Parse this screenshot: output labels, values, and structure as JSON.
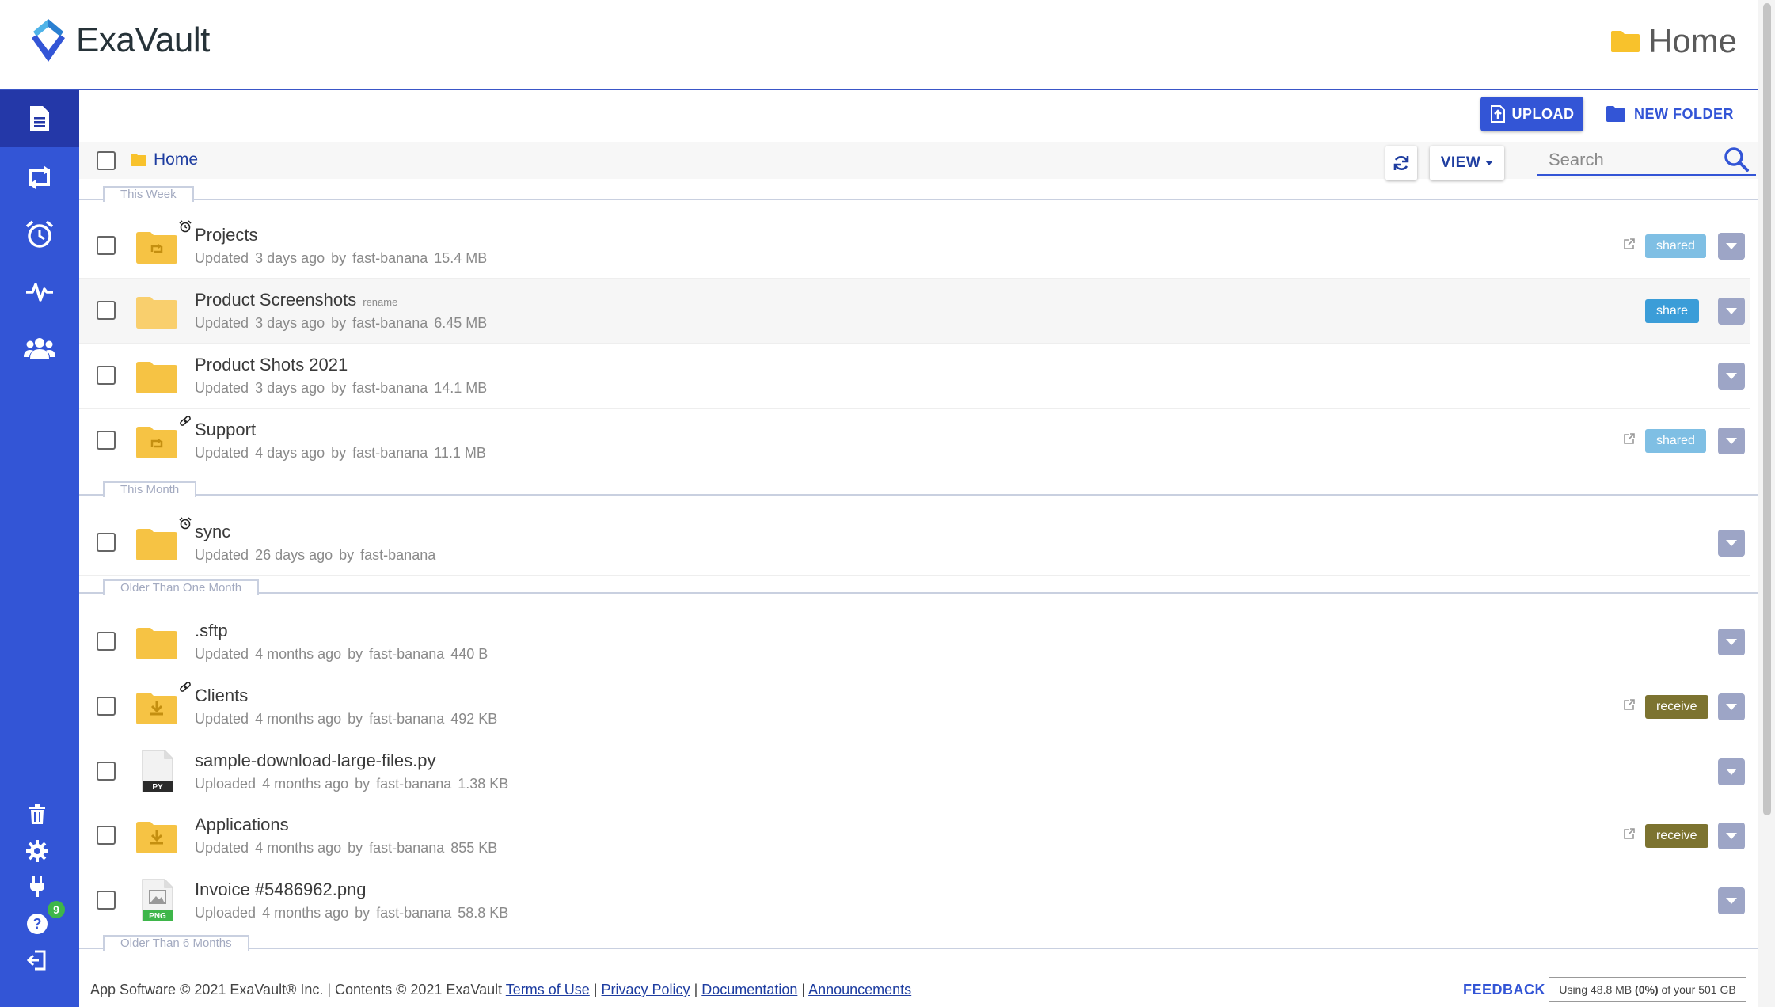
{
  "app": {
    "name": "ExaVault"
  },
  "header": {
    "title": "Home"
  },
  "actions": {
    "upload_label": "UPLOAD",
    "new_folder_label": "NEW FOLDER"
  },
  "toolbar": {
    "breadcrumb": "Home",
    "view_label": "VIEW",
    "search_placeholder": "Search"
  },
  "sidebar": {
    "items": [
      {
        "icon": "file-icon",
        "active": true
      },
      {
        "icon": "sync-icon",
        "active": false
      },
      {
        "icon": "alarm-clock-icon",
        "active": false
      },
      {
        "icon": "activity-icon",
        "active": false
      },
      {
        "icon": "users-icon",
        "active": false
      }
    ],
    "bottom_items": [
      "trash-icon",
      "gear-icon",
      "plug-icon",
      "help-icon",
      "logout-icon"
    ],
    "help_badge": "9"
  },
  "groups": [
    {
      "label": "This Week"
    },
    {
      "label": "This Month"
    },
    {
      "label": "Older Than One Month"
    },
    {
      "label": "Older Than 6 Months"
    }
  ],
  "files": [
    {
      "name": "Projects",
      "action": "Updated",
      "age": "3 days ago",
      "by": "by",
      "user": "fast-banana",
      "size": "15.4 MB",
      "icon": "sync-folder-icon",
      "indicator": "alarm-icon",
      "share_status": "shared"
    },
    {
      "name": "Product Screenshots",
      "hint": "rename",
      "action": "Updated",
      "age": "3 days ago",
      "by": "by",
      "user": "fast-banana",
      "size": "6.45 MB",
      "icon": "folder-icon",
      "share_status": "share"
    },
    {
      "name": "Product Shots 2021",
      "action": "Updated",
      "age": "3 days ago",
      "by": "by",
      "user": "fast-banana",
      "size": "14.1 MB",
      "icon": "folder-icon"
    },
    {
      "name": "Support",
      "action": "Updated",
      "age": "4 days ago",
      "by": "by",
      "user": "fast-banana",
      "size": "11.1 MB",
      "icon": "sync-folder-icon",
      "indicator": "link-icon",
      "share_status": "shared"
    },
    {
      "name": "sync",
      "action": "Updated",
      "age": "26 days ago",
      "by": "by",
      "user": "fast-banana",
      "size": "",
      "icon": "folder-icon",
      "indicator": "alarm-icon"
    },
    {
      "name": ".sftp",
      "action": "Updated",
      "age": "4 months ago",
      "by": "by",
      "user": "fast-banana",
      "size": "440 B",
      "icon": "folder-icon"
    },
    {
      "name": "Clients",
      "action": "Updated",
      "age": "4 months ago",
      "by": "by",
      "user": "fast-banana",
      "size": "492 KB",
      "icon": "receive-folder-icon",
      "indicator": "link-icon",
      "share_status": "receive"
    },
    {
      "name": "sample-download-large-files.py",
      "action": "Uploaded",
      "age": "4 months ago",
      "by": "by",
      "user": "fast-banana",
      "size": "1.38 KB",
      "icon": "py-file-icon",
      "file_badge": "PY"
    },
    {
      "name": "Applications",
      "action": "Updated",
      "age": "4 months ago",
      "by": "by",
      "user": "fast-banana",
      "size": "855 KB",
      "icon": "receive-folder-icon",
      "share_status": "receive"
    },
    {
      "name": "Invoice #5486962.png",
      "action": "Uploaded",
      "age": "4 months ago",
      "by": "by",
      "user": "fast-banana",
      "size": "58.8 KB",
      "icon": "png-file-icon",
      "file_badge": "PNG"
    }
  ],
  "footer": {
    "copyright": "App Software © 2021 ExaVault® Inc. | Contents © 2021 ExaVault",
    "links": [
      "Terms of Use",
      "Privacy Policy",
      "Documentation",
      "Announcements"
    ],
    "sep": "|",
    "feedback": "FEEDBACK",
    "usage_prefix": "Using 48.8 MB",
    "usage_percent": "(0%)",
    "usage_suffix": "of your 501 GB"
  },
  "colors": {
    "sidebar": "#3355d6",
    "sidebar_active": "#2438a8",
    "folder": "#f6c344",
    "shared_pill": "#7fbfe4",
    "share_pill": "#3b9dd8",
    "receive_pill": "#7c7330",
    "row_menu": "#9da5c6"
  }
}
